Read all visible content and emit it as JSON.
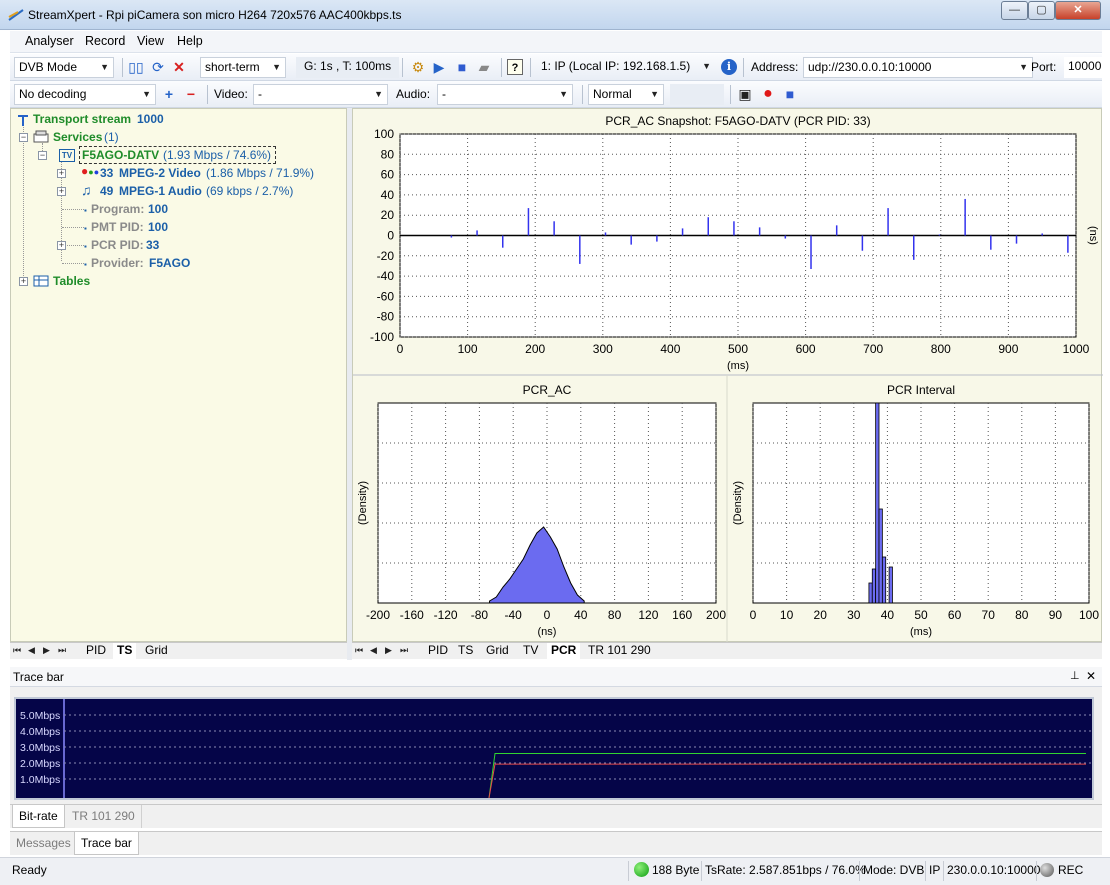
{
  "window": {
    "title": "StreamXpert - Rpi piCamera son micro H264 720x576 AAC400kbps.ts",
    "minimize": "—",
    "maximize": "▢",
    "close": "✕"
  },
  "menu": [
    "Analyser",
    "Record",
    "View",
    "Help"
  ],
  "toolbar1": {
    "mode": "DVB Mode",
    "term": "short-term",
    "gt": "G: 1s , T: 100ms",
    "interface": "1: IP (Local IP: 192.168.1.5)",
    "address_label": "Address:",
    "address": "udp://230.0.0.10:10000",
    "port_label": "Port:",
    "port": "10000"
  },
  "toolbar2": {
    "decoding": "No decoding",
    "video_label": "Video:",
    "video": "-",
    "audio_label": "Audio:",
    "audio": "-",
    "priority": "Normal"
  },
  "tree": {
    "ts_label": "Transport stream",
    "ts_id": "1000",
    "services_label": "Services",
    "services_count": "(1)",
    "service_icon": "TV",
    "service_name": "F5AGO-DATV",
    "service_rate": "(1.93 Mbps / 74.6%)",
    "video_pid": "33",
    "video_name": "MPEG-2 Video",
    "video_rate": "(1.86 Mbps / 71.9%)",
    "audio_pid": "49",
    "audio_name": "MPEG-1 Audio",
    "audio_rate": "(69 kbps / 2.7%)",
    "program_label": "Program:",
    "program_value": "100",
    "pmt_label": "PMT PID:",
    "pmt_value": "100",
    "pcr_label": "PCR PID:",
    "pcr_value": "33",
    "provider_label": "Provider:",
    "provider_value": "F5AGO",
    "tables_label": "Tables"
  },
  "left_tabs": [
    "PID",
    "TS",
    "Grid"
  ],
  "left_active_tab": "TS",
  "right_tabs": [
    "PID",
    "TS",
    "Grid",
    "TV",
    "PCR",
    "TR 101 290"
  ],
  "right_active_tab": "PCR",
  "trace": {
    "header": "Trace bar",
    "pin_icon": "pin-icon",
    "close_icon": "close-icon",
    "ylabels": [
      "5.0Mbps",
      "4.0Mbps",
      "3.0Mbps",
      "2.0Mbps",
      "1.0Mbps"
    ],
    "colors": {
      "background": "#050548",
      "total": "#31d431",
      "service": "#e84a4a"
    }
  },
  "trace_tabs": [
    "Bit-rate",
    "TR 101 290"
  ],
  "trace_active_tab": "Bit-rate",
  "bottom_tabs": [
    "Messages",
    "Trace bar"
  ],
  "bottom_active_tab": "Trace bar",
  "status": {
    "ready": "Ready",
    "bytes": "188 Byte",
    "tsrate": "TsRate: 2.587.851bps / 76.0%",
    "mode": "Mode: DVB",
    "proto": "IP",
    "address": "230.0.0.10:10000",
    "rec": "REC"
  },
  "chart_data": [
    {
      "type": "bar",
      "title": "PCR_AC Snapshot: F5AGO-DATV (PCR PID: 33)",
      "xlabel": "(ms)",
      "ylabel": "(ns)",
      "xlim": [
        0,
        1000
      ],
      "ylim": [
        -100,
        100
      ],
      "xticks": [
        0,
        100,
        200,
        300,
        400,
        500,
        600,
        700,
        800,
        900,
        1000
      ],
      "yticks": [
        100,
        80,
        60,
        40,
        20,
        0,
        -20,
        -40,
        -60,
        -80,
        -100
      ],
      "grid": true,
      "color": "#3333ee",
      "x": [
        76,
        114,
        152,
        190,
        228,
        266,
        304,
        342,
        380,
        418,
        456,
        494,
        532,
        570,
        608,
        646,
        684,
        722,
        760,
        798,
        836,
        874,
        912,
        950,
        988
      ],
      "values": [
        -2,
        5,
        -12,
        27,
        14,
        -28,
        3,
        -9,
        -6,
        7,
        18,
        14,
        8,
        -3,
        -33,
        10,
        -15,
        27,
        -24,
        1,
        36,
        -14,
        -8,
        2,
        -17
      ]
    },
    {
      "type": "area",
      "title": "PCR_AC",
      "xlabel": "(ns)",
      "ylabel": "(Density)",
      "xlim": [
        -200,
        200
      ],
      "xticks": [
        -200,
        -160,
        -120,
        -80,
        -40,
        0,
        40,
        80,
        120,
        160,
        200
      ],
      "grid": true,
      "color": "#6b6bf0",
      "x": [
        -68,
        -60,
        -52,
        -44,
        -36,
        -28,
        -20,
        -12,
        -4,
        4,
        12,
        20,
        28,
        36,
        44
      ],
      "values": [
        0.01,
        0.03,
        0.08,
        0.12,
        0.17,
        0.22,
        0.29,
        0.35,
        0.38,
        0.33,
        0.27,
        0.18,
        0.1,
        0.04,
        0.01
      ]
    },
    {
      "type": "bar",
      "title": "PCR Interval",
      "xlabel": "(ms)",
      "ylabel": "(Density)",
      "xlim": [
        0,
        100
      ],
      "xticks": [
        0,
        10,
        20,
        30,
        40,
        50,
        60,
        70,
        80,
        90,
        100
      ],
      "grid": true,
      "color": "#6b6bf0",
      "x": [
        35,
        36,
        37,
        38,
        39,
        40,
        41
      ],
      "values": [
        0.1,
        0.17,
        1.0,
        0.47,
        0.23,
        0.0,
        0.18
      ]
    }
  ]
}
